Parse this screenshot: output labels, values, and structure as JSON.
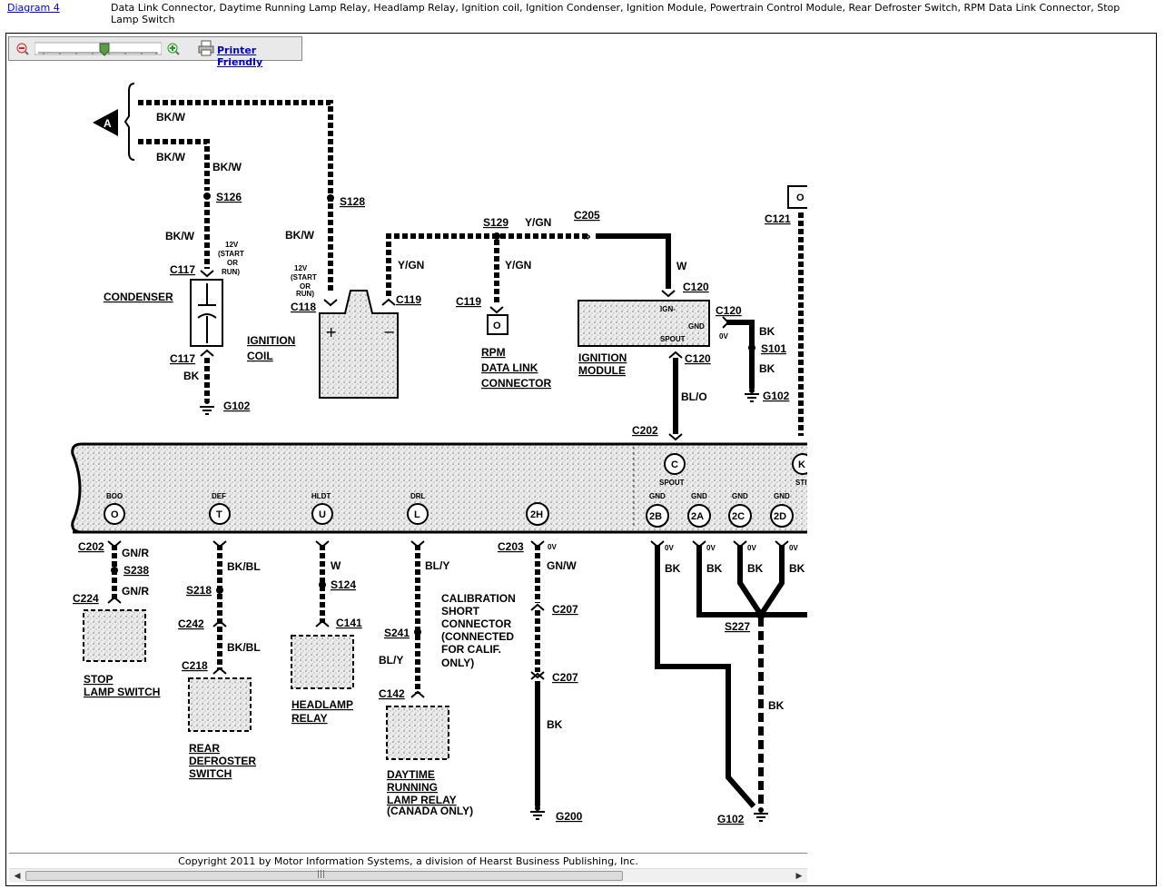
{
  "header": {
    "diagram_link": "Diagram 4",
    "components": "Data Link Connector, Daytime Running Lamp Relay, Headlamp Relay, Ignition coil, Ignition Condenser, Ignition Module, Powertrain Control Module, Rear Defroster Switch, RPM Data Link Connector, Stop Lamp Switch"
  },
  "toolbar": {
    "printer_friendly": "Printer Friendly"
  },
  "diagram": {
    "connector_a": "A",
    "wire_bkw": "BK/W",
    "wire_ygn": "Y/GN",
    "wire_w": "W",
    "wire_bk": "BK",
    "wire_blo": "BL/O",
    "wire_gnr": "GN/R",
    "wire_bkbl": "BK/BL",
    "wire_bly": "BL/Y",
    "wire_gnw": "GN/W",
    "s126": "S126",
    "s128": "S128",
    "s129": "S129",
    "c205": "C205",
    "c121": "C121",
    "c117": "C117",
    "c118": "C118",
    "c119": "C119",
    "c120": "C120",
    "s101": "S101",
    "g102": "G102",
    "c202": "C202",
    "c203": "C203",
    "s238": "S238",
    "c224": "C224",
    "s218": "S218",
    "c242": "C242",
    "c218": "C218",
    "s124": "S124",
    "c141": "C141",
    "s241": "S241",
    "c142": "C142",
    "c207": "C207",
    "g200": "G200",
    "s227": "S227",
    "v12": "12V",
    "start": "(START",
    "or": "OR",
    "run": "RUN)",
    "ov": "0V",
    "condenser": "CONDENSER",
    "ignition": "IGNITION",
    "coil": "COIL",
    "rpm": "RPM",
    "data_link": "DATA LINK",
    "connector": "CONNECTOR",
    "module": "MODULE",
    "ign": "IGN-",
    "gnd": "GND",
    "spout": "SPOUT",
    "pin_boo": "BOO",
    "pin_def": "DEF",
    "pin_hldt": "HLDT",
    "pin_drl": "DRL",
    "pin_o": "O",
    "pin_t": "T",
    "pin_u": "U",
    "pin_l": "L",
    "pin_2h": "2H",
    "pin_c": "C",
    "pin_2b": "2B",
    "pin_2a": "2A",
    "pin_2c": "2C",
    "pin_2d": "2D",
    "pin_k": "K",
    "pin_st": "STI",
    "stop": "STOP",
    "lamp_switch": "LAMP SWITCH",
    "rear": "REAR",
    "defroster": "DEFROSTER",
    "switch": "SWITCH",
    "headlamp": "HEADLAMP",
    "relay": "RELAY",
    "cal1": "CALIBRATION",
    "cal2": "SHORT",
    "cal3": "CONNECTOR",
    "cal4": "(CONNECTED",
    "cal5": "FOR CALIF.",
    "cal6": "ONLY)",
    "daytime": "DAYTIME",
    "running": "RUNNING",
    "lamp_relay": "LAMP RELAY",
    "canada": "(CANADA ONLY)"
  },
  "footer": {
    "copyright": "Copyright 2011 by Motor Information Systems, a division of Hearst Business Publishing, Inc."
  }
}
